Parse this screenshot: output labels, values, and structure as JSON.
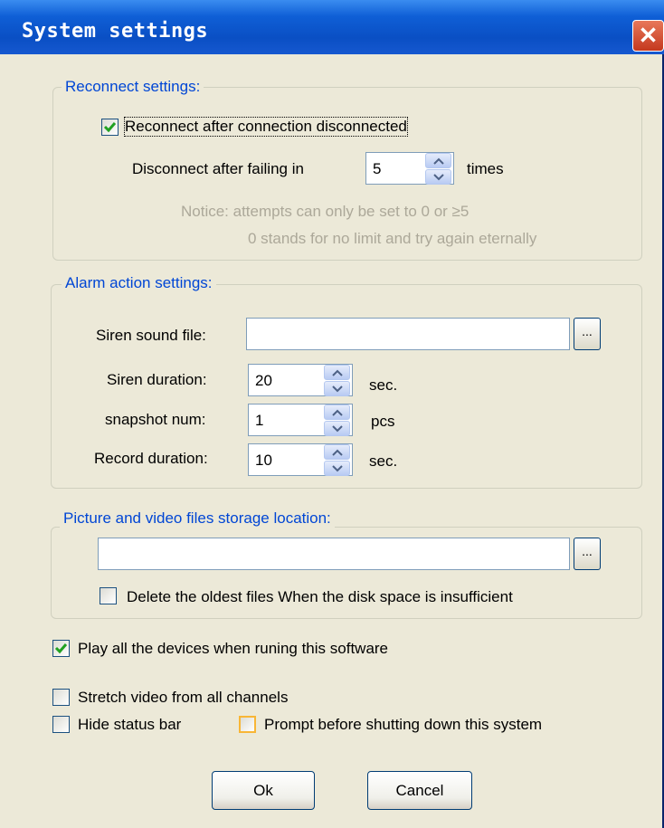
{
  "window": {
    "title": "System settings",
    "close_glyph": "✕"
  },
  "reconnect": {
    "title": "Reconnect settings:",
    "checkbox_label": "Reconnect after connection disconnected",
    "checked": true,
    "fail_prefix": "Disconnect after failing in",
    "fail_value": "5",
    "fail_suffix": "times",
    "notice_1": "Notice: attempts can only be set to 0 or ≥5",
    "notice_2": "0 stands for no limit and try again eternally"
  },
  "alarm": {
    "title": "Alarm action settings:",
    "siren_file_label": "Siren sound file:",
    "siren_file_value": "",
    "browse_label": "...",
    "siren_duration_label": "Siren duration:",
    "siren_duration_value": "20",
    "siren_duration_unit": "sec.",
    "snapshot_label": "snapshot num:",
    "snapshot_value": "1",
    "snapshot_unit": "pcs",
    "record_label": "Record duration:",
    "record_value": "10",
    "record_unit": "sec."
  },
  "storage": {
    "title": "Picture and video files storage location:",
    "path_value": "",
    "browse_label": "...",
    "delete_label": "Delete the oldest files When the disk space is insufficient",
    "delete_checked": false
  },
  "options": {
    "play_all_label": "Play all the devices when runing this software",
    "play_all_checked": true,
    "stretch_label": "Stretch video from all channels",
    "stretch_checked": false,
    "hide_status_label": "Hide status bar",
    "hide_status_checked": false,
    "prompt_label": "Prompt before shutting down this system",
    "prompt_checked": false
  },
  "buttons": {
    "ok": "Ok",
    "cancel": "Cancel"
  },
  "icons": {
    "close": "close-icon",
    "check": "check-icon",
    "spin_up": "chevron-up-icon",
    "spin_down": "chevron-down-icon"
  },
  "colors": {
    "titlebar": "#0a4fc4",
    "group_title": "#0046d5",
    "check": "#21a121",
    "close": "#c4381e"
  }
}
